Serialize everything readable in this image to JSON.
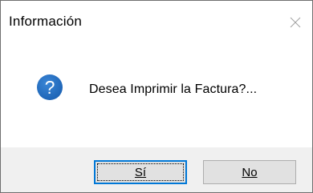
{
  "window": {
    "title": "Información"
  },
  "dialog": {
    "icon": "question-icon",
    "message": "Desea Imprimir la Factura?..."
  },
  "buttons": {
    "yes_label": "Sí",
    "no_label": "No"
  },
  "colors": {
    "icon_blue": "#1c62b4",
    "focus_border": "#0078d7",
    "button_bg": "#e1e1e1",
    "footer_bg": "#f0f0f0"
  }
}
